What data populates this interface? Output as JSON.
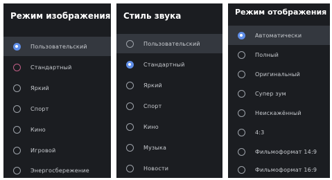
{
  "colors": {
    "panel_bg": "#1b1d21",
    "selected_bg": "#34383f",
    "accent": "#5f8ee8",
    "title_text": "#ffffff",
    "item_text": "#c9ccd1"
  },
  "panels": [
    {
      "title": "Режим изображения",
      "items": [
        {
          "label": "Пользовательский",
          "state": "checked"
        },
        {
          "label": "Стандартный",
          "state": "focused"
        },
        {
          "label": "Яркий",
          "state": "unchecked"
        },
        {
          "label": "Спорт",
          "state": "unchecked"
        },
        {
          "label": "Кино",
          "state": "unchecked"
        },
        {
          "label": "Игровой",
          "state": "unchecked"
        },
        {
          "label": "Энергосбережение",
          "state": "unchecked"
        }
      ]
    },
    {
      "title": "Стиль звука",
      "items": [
        {
          "label": "Пользовательский",
          "state": "unchecked"
        },
        {
          "label": "Стандартный",
          "state": "checked"
        },
        {
          "label": "Яркий",
          "state": "unchecked"
        },
        {
          "label": "Спорт",
          "state": "unchecked"
        },
        {
          "label": "Кино",
          "state": "unchecked"
        },
        {
          "label": "Музыка",
          "state": "unchecked"
        },
        {
          "label": "Новости",
          "state": "unchecked"
        }
      ]
    },
    {
      "title": "Режим отображения",
      "items": [
        {
          "label": "Автоматически",
          "state": "checked"
        },
        {
          "label": "Полный",
          "state": "unchecked"
        },
        {
          "label": "Оригинальный",
          "state": "unchecked"
        },
        {
          "label": "Супер зум",
          "state": "unchecked"
        },
        {
          "label": "Неискажённый",
          "state": "unchecked"
        },
        {
          "label": "4:3",
          "state": "unchecked"
        },
        {
          "label": "Фильмоформат 14:9",
          "state": "unchecked"
        },
        {
          "label": "Фильмоформат 16:9",
          "state": "unchecked"
        }
      ]
    }
  ]
}
